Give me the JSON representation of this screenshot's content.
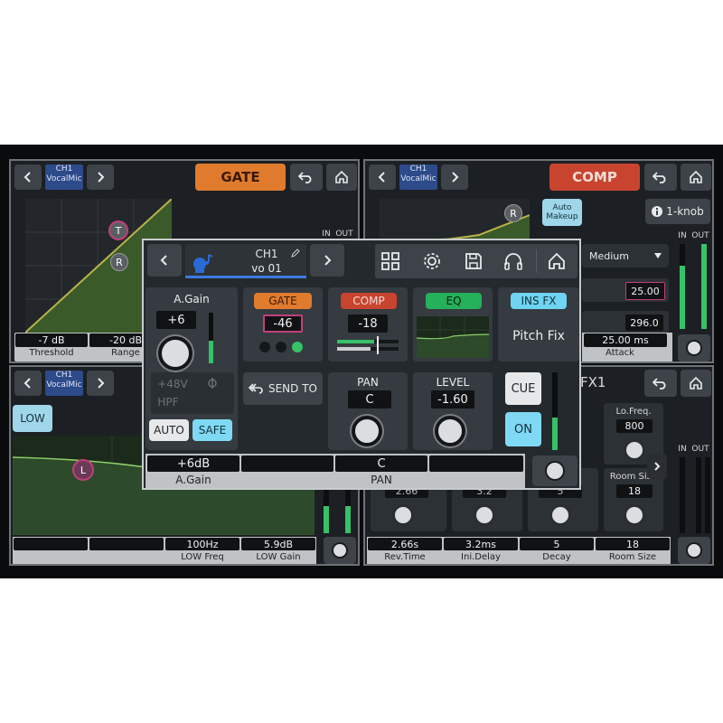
{
  "channel": {
    "number": "CH1",
    "name": "VocalMic"
  },
  "gate_panel": {
    "title": "GATE",
    "threshold_value": "-7 dB",
    "range_value": "-20 dB",
    "threshold_label": "Threshold",
    "range_label": "Range",
    "marker_t": "T",
    "marker_r": "R",
    "in_label": "IN",
    "out_label": "OUT"
  },
  "comp_panel": {
    "title": "COMP",
    "auto_makeup": "Auto\nMakeup",
    "one_knob": "1-knob",
    "knee": "Medium",
    "val1": "25.00",
    "val2": "296.0",
    "attack_value": "25.00 ms",
    "attack_label": "Attack",
    "marker_r": "R",
    "in_label": "IN",
    "out_label": "OUT"
  },
  "eq_panel": {
    "low_button": "LOW",
    "freq_value": "100Hz",
    "gain_value": "5.9dB",
    "freq_label": "LOW Freq",
    "gain_label": "LOW Gain",
    "marker_l": "L"
  },
  "fx_panel": {
    "title": "FX1",
    "lofreq_label": "Lo.Freq.",
    "lofreq_value": "800",
    "roomsize_label": "Room Size",
    "roomsize_value": "18",
    "knob_vals": [
      "2.66",
      "3.2",
      "5"
    ],
    "in_label": "IN",
    "out_label": "OUT",
    "bottom": [
      {
        "value": "2.66s",
        "label": "Rev.Time"
      },
      {
        "value": "3.2ms",
        "label": "Ini.Delay"
      },
      {
        "value": "5",
        "label": "Decay"
      },
      {
        "value": "18",
        "label": "Room Size"
      }
    ]
  },
  "overlay": {
    "channel_number": "CH1",
    "channel_name": "vo 01",
    "again_title": "A.Gain",
    "again_value": "+6",
    "phantom": "+48V",
    "hpf": "HPF",
    "auto": "AUTO",
    "safe": "SAFE",
    "gate_label": "GATE",
    "gate_value": "-46",
    "comp_label": "COMP",
    "comp_value": "-18",
    "eq_label": "EQ",
    "insfx_label": "INS FX",
    "insfx_value": "Pitch Fix",
    "send_to": "SEND TO",
    "pan_label": "PAN",
    "pan_value": "C",
    "level_label": "LEVEL",
    "level_value": "-1.60",
    "cue": "CUE",
    "on": "ON",
    "bottom_cells": [
      {
        "value": "+6dB",
        "label": "A.Gain"
      },
      {
        "value": "",
        "label": ""
      },
      {
        "value": "C",
        "label": "PAN"
      },
      {
        "value": "",
        "label": ""
      }
    ]
  },
  "colors": {
    "gate": "#e07b2e",
    "comp": "#c8442f",
    "eq": "#25b05a",
    "insfx": "#6fd3f2",
    "cue": "#e6e8ea",
    "on": "#7fd9f4",
    "meter": "#35c268",
    "accent_pink": "#c2407a"
  },
  "icons": [
    "chevron-left-icon",
    "chevron-right-icon",
    "undo-icon",
    "home-icon",
    "grid-icon",
    "gear-icon",
    "save-icon",
    "headphones-icon",
    "pencil-icon",
    "mic-icon",
    "send-icon",
    "power-icon",
    "info-icon",
    "caret-down-icon"
  ]
}
